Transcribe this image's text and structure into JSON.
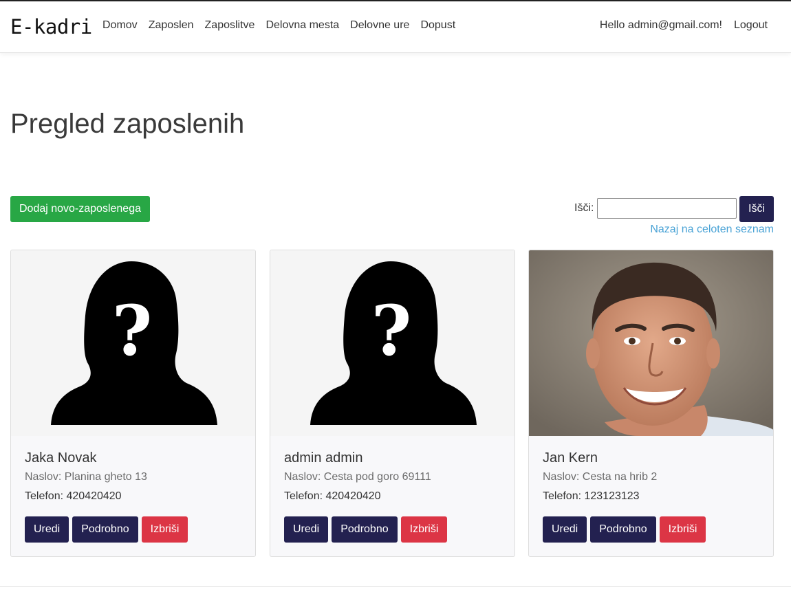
{
  "navbar": {
    "brand": "E-kadri",
    "links": [
      "Domov",
      "Zaposlen",
      "Zaposlitve",
      "Delovna mesta",
      "Delovne ure",
      "Dopust"
    ],
    "greeting": "Hello admin@gmail.com!",
    "logout": "Logout"
  },
  "page": {
    "title": "Pregled zaposlenih",
    "add_button": "Dodaj novo-zaposlenega",
    "search_label": "Išči:",
    "search_value": "",
    "search_button": "Išči",
    "back_link": "Nazaj na celoten seznam"
  },
  "employees": [
    {
      "name": "Jaka Novak",
      "address": "Naslov: Planina gheto 13",
      "phone": "Telefon: 420420420",
      "photo": "placeholder-silhouette-icon"
    },
    {
      "name": "admin admin",
      "address": "Naslov: Cesta pod goro 69111",
      "phone": "Telefon: 420420420",
      "photo": "placeholder-silhouette-icon"
    },
    {
      "name": "Jan Kern",
      "address": "Naslov: Cesta na hrib 2",
      "phone": "Telefon: 123123123",
      "photo": "portrait-photo"
    }
  ],
  "card_actions": {
    "edit": "Uredi",
    "details": "Podrobno",
    "delete": "Izbriši"
  },
  "colors": {
    "success": "#28a745",
    "primary": "#232150",
    "danger": "#dc3545",
    "link": "#4aa3d6"
  }
}
